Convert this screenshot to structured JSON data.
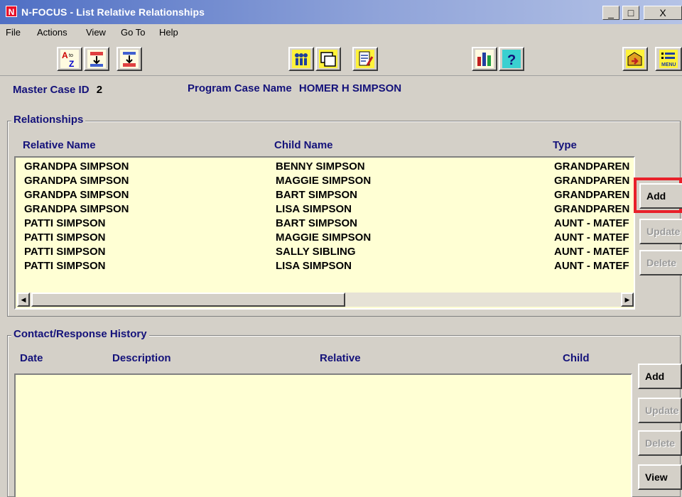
{
  "window": {
    "title": "N-FOCUS - List Relative Relationships",
    "app_icon_letter": "N",
    "controls": [
      "_",
      "□",
      "X"
    ]
  },
  "menu": [
    "File",
    "Actions",
    "View",
    "Go To",
    "Help"
  ],
  "toolbar_icons": [
    "sort-a-z-icon",
    "sort-ascending-icon",
    "sort-descending-icon",
    "people-icon",
    "window-icon",
    "document-pencil-icon",
    "bar-chart-icon",
    "help-icon",
    "exit-icon",
    "menu-icon"
  ],
  "header": {
    "master_case_label": "Master Case ID",
    "master_case_value": "2",
    "program_case_label": "Program Case Name",
    "program_case_value": "HOMER H SIMPSON"
  },
  "relationships": {
    "title": "Relationships",
    "columns": [
      "Relative Name",
      "Child Name",
      "Type"
    ],
    "rows": [
      [
        "GRANDPA SIMPSON",
        "BENNY SIMPSON",
        "GRANDPAREN"
      ],
      [
        "GRANDPA SIMPSON",
        "MAGGIE SIMPSON",
        "GRANDPAREN"
      ],
      [
        "GRANDPA SIMPSON",
        "BART SIMPSON",
        "GRANDPAREN"
      ],
      [
        "GRANDPA SIMPSON",
        "LISA SIMPSON",
        "GRANDPAREN"
      ],
      [
        "PATTI SIMPSON",
        "BART SIMPSON",
        "AUNT - MATEF"
      ],
      [
        "PATTI SIMPSON",
        "MAGGIE SIMPSON",
        "AUNT - MATEF"
      ],
      [
        "PATTI SIMPSON",
        "SALLY SIBLING",
        "AUNT - MATEF"
      ],
      [
        "PATTI SIMPSON",
        "LISA SIMPSON",
        "AUNT - MATEF"
      ]
    ],
    "buttons": {
      "add": "Add",
      "update": "Update",
      "delete": "Delete"
    },
    "highlight_color": "#e8202a"
  },
  "contacts": {
    "title": "Contact/Response History",
    "columns": [
      "Date",
      "Description",
      "Relative",
      "Child"
    ],
    "buttons": {
      "add": "Add",
      "update": "Update",
      "delete": "Delete",
      "view": "View"
    }
  },
  "colors": {
    "listbox_bg": "#ffffd4",
    "label_navy": "#14127a",
    "window_bg": "#d4d0c8"
  }
}
